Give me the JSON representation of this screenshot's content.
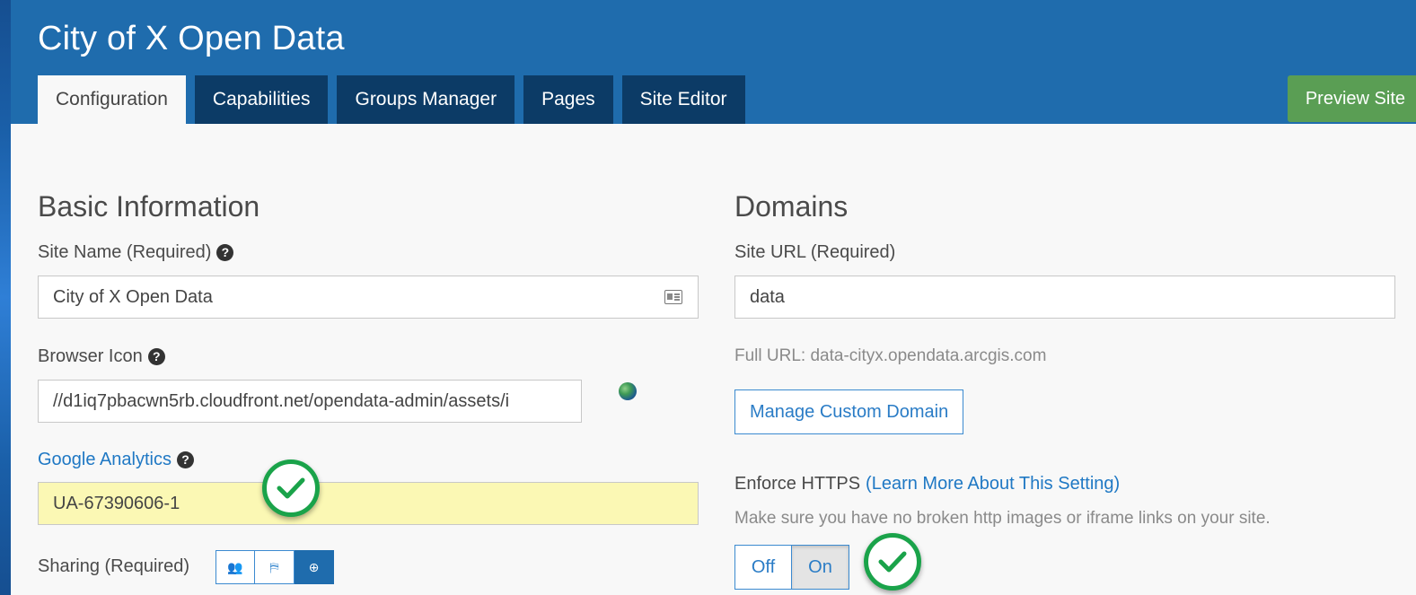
{
  "app": {
    "title": "City of X Open Data"
  },
  "tabs": [
    {
      "label": "Configuration",
      "active": true
    },
    {
      "label": "Capabilities",
      "active": false
    },
    {
      "label": "Groups Manager",
      "active": false
    },
    {
      "label": "Pages",
      "active": false
    },
    {
      "label": "Site Editor",
      "active": false
    }
  ],
  "header": {
    "preview_label": "Preview Site"
  },
  "basic_info": {
    "title": "Basic Information",
    "site_name_label": "Site Name (Required)",
    "site_name_value": "City of X Open Data",
    "browser_icon_label": "Browser Icon",
    "browser_icon_value": "//d1iq7pbacwn5rb.cloudfront.net/opendata-admin/assets/i",
    "google_analytics_label": "Google Analytics",
    "google_analytics_value": "UA-67390606-1",
    "sharing_label": "Sharing (Required)",
    "sharing_options": [
      {
        "icon": "group-icon",
        "glyph": "👥",
        "active": false
      },
      {
        "icon": "organization-icon",
        "glyph": "⛿",
        "active": false
      },
      {
        "icon": "public-icon",
        "glyph": "⊕",
        "active": true
      }
    ]
  },
  "domains": {
    "title": "Domains",
    "site_url_label": "Site URL (Required)",
    "site_url_value": "data",
    "full_url_text": "Full URL: data-cityx.opendata.arcgis.com",
    "manage_domain_label": "Manage Custom Domain",
    "enforce_https_label": "Enforce HTTPS",
    "learn_more_label": "(Learn More About This Setting)",
    "https_hint": "Make sure you have no broken http images or iframe links on your site.",
    "toggle_off_label": "Off",
    "toggle_on_label": "On",
    "https_enabled": true
  },
  "colors": {
    "header": "#1f6cad",
    "tab_dark": "#0c3b66",
    "preview": "#5a9e54",
    "check": "#1aa34a",
    "highlight": "#fbf8b4"
  }
}
